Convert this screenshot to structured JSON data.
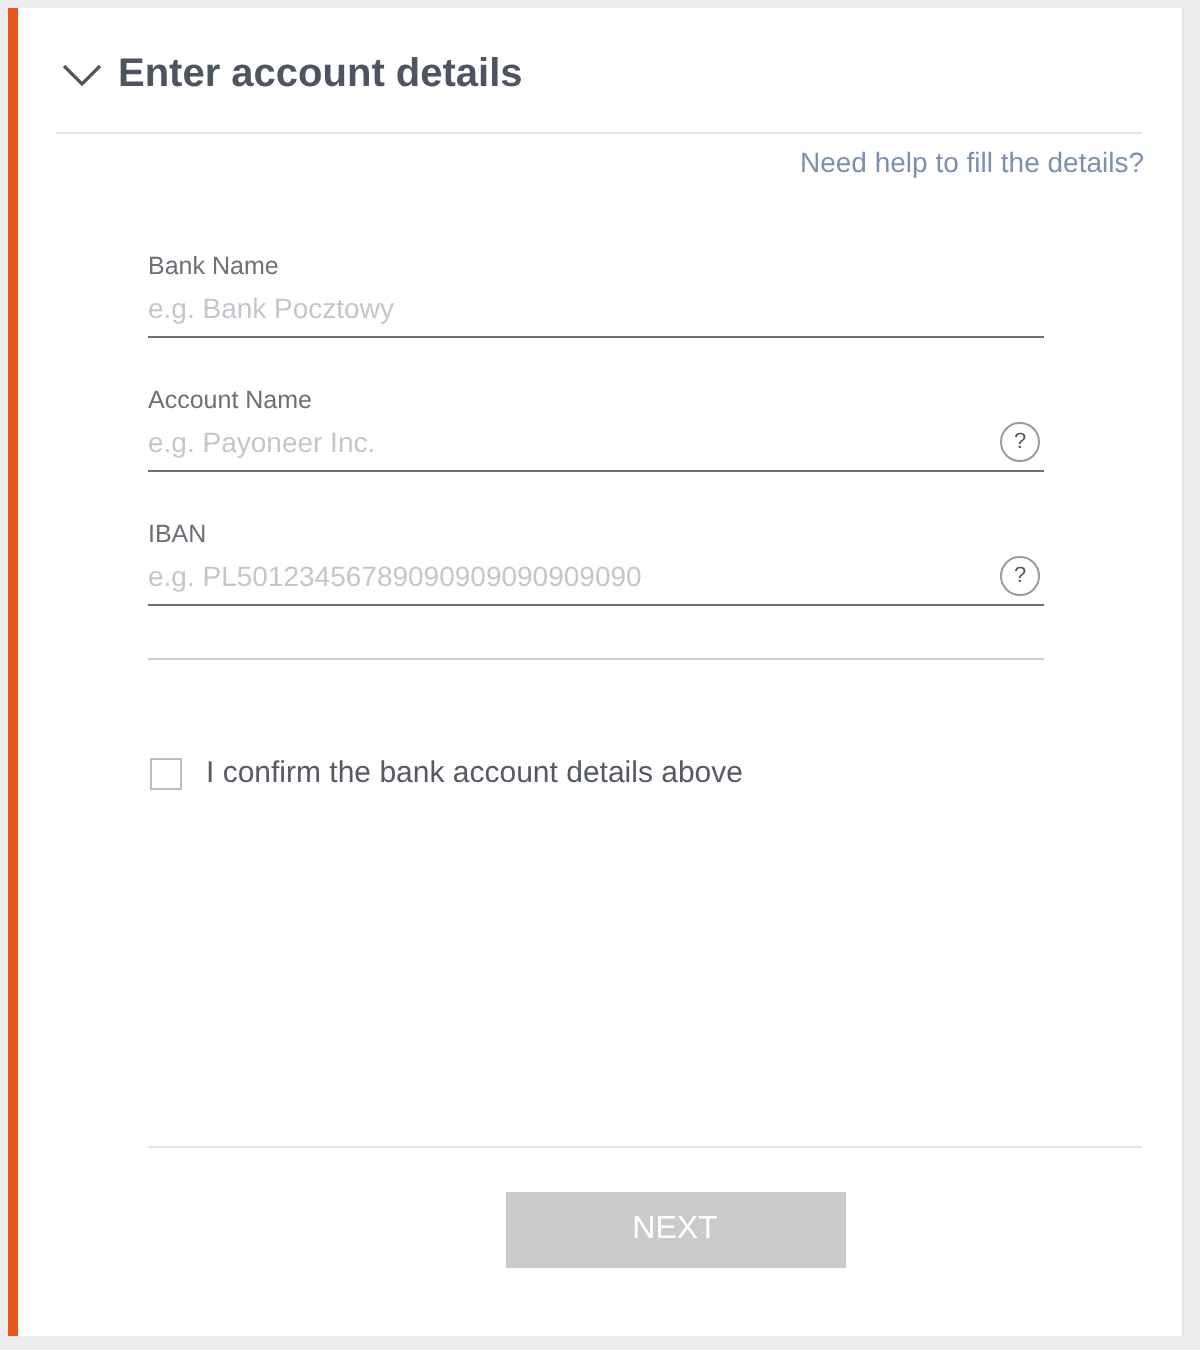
{
  "section": {
    "title": "Enter account details",
    "expanded": true
  },
  "help_link": "Need help to fill the details?",
  "fields": [
    {
      "label": "Bank Name",
      "placeholder": "e.g. Bank Pocztowy"
    },
    {
      "label": "Account Name",
      "placeholder": "e.g. Payoneer Inc.",
      "help": "?"
    },
    {
      "label": "IBAN",
      "placeholder": "e.g. PL50123456789090909090909090",
      "help": "?"
    }
  ],
  "confirm": {
    "label": "I confirm the bank account details above",
    "checked": false
  },
  "next_button": {
    "label": "NEXT",
    "disabled": true
  }
}
